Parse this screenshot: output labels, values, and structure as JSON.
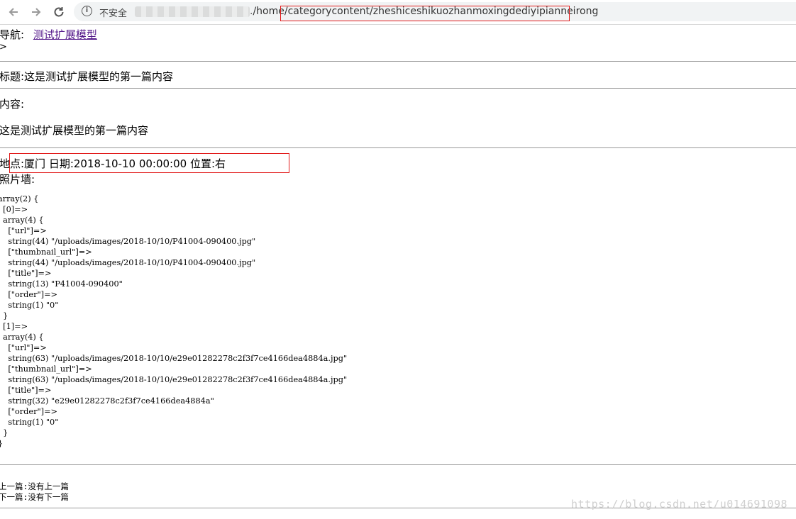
{
  "browser": {
    "security_label": "不安全",
    "url_path": "/home/categorycontent/zheshiceshikuozhanmoxingdediyipianneirong",
    "url_prefix_dot": "."
  },
  "nav": {
    "label": "导航:",
    "link": "测试扩展模型",
    "arrow": ">"
  },
  "title_line": "标题:这是测试扩展模型的第一篇内容",
  "content_label": "内容:",
  "content_body": "这是测试扩展模型的第一篇内容",
  "meta_line": "地点:厦门 日期:2018-10-10 00:00:00 位置:右",
  "photo_label": "照片墙:",
  "var_dump": "array(2) {\n  [0]=>\n  array(4) {\n    [\"url\"]=>\n    string(44) \"/uploads/images/2018-10/10/P41004-090400.jpg\"\n    [\"thumbnail_url\"]=>\n    string(44) \"/uploads/images/2018-10/10/P41004-090400.jpg\"\n    [\"title\"]=>\n    string(13) \"P41004-090400\"\n    [\"order\"]=>\n    string(1) \"0\"\n  }\n  [1]=>\n  array(4) {\n    [\"url\"]=>\n    string(63) \"/uploads/images/2018-10/10/e29e01282278c2f3f7ce4166dea4884a.jpg\"\n    [\"thumbnail_url\"]=>\n    string(63) \"/uploads/images/2018-10/10/e29e01282278c2f3f7ce4166dea4884a.jpg\"\n    [\"title\"]=>\n    string(32) \"e29e01282278c2f3f7ce4166dea4884a\"\n    [\"order\"]=>\n    string(1) \"0\"\n  }\n}",
  "prev_line": "上一篇:没有上一篇",
  "next_line": "下一篇:没有下一篇",
  "watermark": "https://blog.csdn.net/u014691098",
  "icons": {
    "back": "back-arrow-icon",
    "forward": "forward-arrow-icon",
    "reload": "reload-icon",
    "info": "info-icon"
  },
  "colors": {
    "annotation_red": "#e21c1c",
    "link_visited": "#551a8b"
  }
}
